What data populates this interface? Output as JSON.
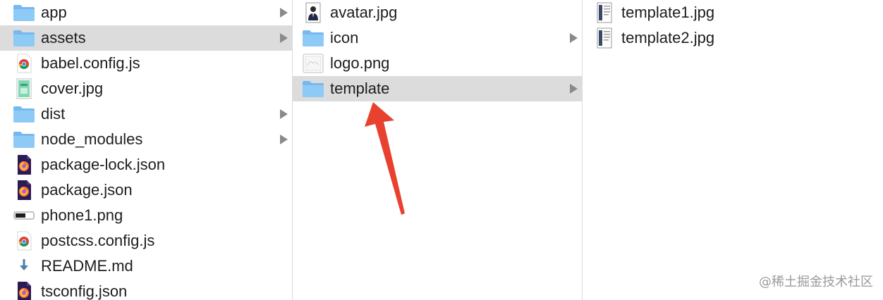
{
  "columns": [
    {
      "items": [
        {
          "name": "app",
          "kind": "folder",
          "icon": "folder-icon",
          "expandable": true
        },
        {
          "name": "assets",
          "kind": "folder",
          "icon": "folder-icon",
          "expandable": true,
          "selected": true
        },
        {
          "name": "babel.config.js",
          "kind": "file",
          "icon": "chrome-js-file-icon"
        },
        {
          "name": "cover.jpg",
          "kind": "file",
          "icon": "image-thumbnail-icon"
        },
        {
          "name": "dist",
          "kind": "folder",
          "icon": "folder-icon",
          "expandable": true
        },
        {
          "name": "node_modules",
          "kind": "folder",
          "icon": "folder-icon",
          "expandable": true
        },
        {
          "name": "package-lock.json",
          "kind": "file",
          "icon": "firefox-json-file-icon"
        },
        {
          "name": "package.json",
          "kind": "file",
          "icon": "firefox-json-file-icon"
        },
        {
          "name": "phone1.png",
          "kind": "file",
          "icon": "phone-thumbnail-icon"
        },
        {
          "name": "postcss.config.js",
          "kind": "file",
          "icon": "chrome-js-file-icon"
        },
        {
          "name": "README.md",
          "kind": "file",
          "icon": "markdown-file-icon"
        },
        {
          "name": "tsconfig.json",
          "kind": "file",
          "icon": "firefox-json-file-icon"
        }
      ]
    },
    {
      "items": [
        {
          "name": "avatar.jpg",
          "kind": "file",
          "icon": "portrait-thumbnail-icon"
        },
        {
          "name": "icon",
          "kind": "folder",
          "icon": "folder-icon",
          "expandable": true
        },
        {
          "name": "logo.png",
          "kind": "file",
          "icon": "image-file-icon"
        },
        {
          "name": "template",
          "kind": "folder",
          "icon": "folder-icon",
          "expandable": true,
          "selected": true
        }
      ]
    },
    {
      "items": [
        {
          "name": "template1.jpg",
          "kind": "file",
          "icon": "document-thumbnail-icon"
        },
        {
          "name": "template2.jpg",
          "kind": "file",
          "icon": "document-thumbnail-icon"
        }
      ]
    }
  ],
  "colors": {
    "folder": "#74b9ef",
    "selection": "#dcdcdc",
    "chevron": "#8a8a8a",
    "annotation_arrow": "#e8412f"
  },
  "annotation": {
    "icon": "red-arrow-icon",
    "target": "template"
  },
  "watermark": "@稀土掘金技术社区"
}
